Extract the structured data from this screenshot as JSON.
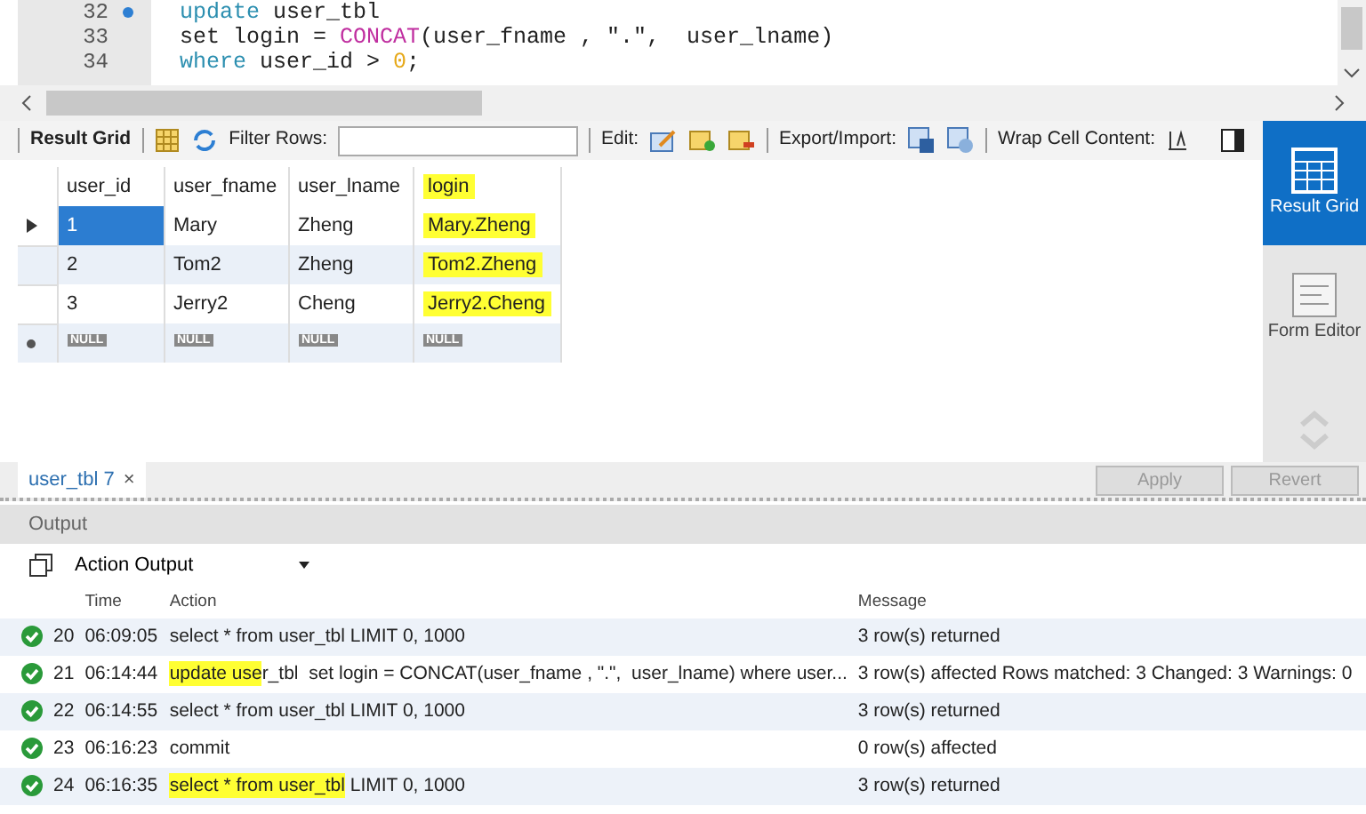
{
  "editor": {
    "lines": [
      {
        "number": "32",
        "marker": true,
        "tokens": [
          {
            "text": "update",
            "kind": "keyword"
          },
          {
            "text": " user_tbl",
            "kind": "plain"
          }
        ]
      },
      {
        "number": "33",
        "marker": false,
        "tokens": [
          {
            "text": "set login = ",
            "kind": "plain"
          },
          {
            "text": "CONCAT",
            "kind": "function"
          },
          {
            "text": "(user_fname , \".\",  user_lname)",
            "kind": "plain"
          }
        ]
      },
      {
        "number": "34",
        "marker": false,
        "tokens": [
          {
            "text": "where",
            "kind": "keyword"
          },
          {
            "text": " user_id > ",
            "kind": "plain"
          },
          {
            "text": "0",
            "kind": "number"
          },
          {
            "text": ";",
            "kind": "plain"
          }
        ]
      }
    ]
  },
  "toolbar": {
    "result_grid": "Result Grid",
    "filter_label": "Filter Rows:",
    "edit_label": "Edit:",
    "export_label": "Export/Import:",
    "wrap_label": "Wrap Cell Content:"
  },
  "grid": {
    "columns": [
      {
        "label": "user_id",
        "highlighted": false
      },
      {
        "label": "user_fname",
        "highlighted": false
      },
      {
        "label": "user_lname",
        "highlighted": false
      },
      {
        "label": "login",
        "highlighted": true
      }
    ],
    "rows": [
      {
        "selected": true,
        "cells": [
          "1",
          "Mary",
          "Zheng",
          "Mary.Zheng"
        ]
      },
      {
        "selected": false,
        "cells": [
          "2",
          "Tom2",
          "Zheng",
          "Tom2.Zheng"
        ]
      },
      {
        "selected": false,
        "cells": [
          "3",
          "Jerry2",
          "Cheng",
          "Jerry2.Cheng"
        ]
      }
    ],
    "new_row": [
      "NULL",
      "NULL",
      "NULL",
      "NULL"
    ]
  },
  "side_panel": [
    {
      "label": "Result Grid",
      "selected": true
    },
    {
      "label": "Form Editor",
      "selected": false
    }
  ],
  "result_tab": {
    "label": "user_tbl 7",
    "close": "×"
  },
  "buttons": [
    "Apply",
    "Revert"
  ],
  "output": {
    "title": "Output",
    "selector": "Action Output",
    "columns": [
      "Time",
      "Action",
      "Message"
    ],
    "rows": [
      {
        "number": "20",
        "time": "06:09:05",
        "action": [
          {
            "text": "select * from user_tbl LIMIT 0, 1000",
            "highlighted": false
          }
        ],
        "message": "3 row(s) returned"
      },
      {
        "number": "21",
        "time": "06:14:44",
        "action": [
          {
            "text": "update use",
            "highlighted": true
          },
          {
            "text": "r_tbl  set login = CONCAT(user_fname , \".\",  user_lname) where user...",
            "highlighted": false
          }
        ],
        "message": "3 row(s) affected Rows matched: 3  Changed: 3  Warnings: 0"
      },
      {
        "number": "22",
        "time": "06:14:55",
        "action": [
          {
            "text": "select * from user_tbl LIMIT 0, 1000",
            "highlighted": false
          }
        ],
        "message": "3 row(s) returned"
      },
      {
        "number": "23",
        "time": "06:16:23",
        "action": [
          {
            "text": "commit",
            "highlighted": false
          }
        ],
        "message": "0 row(s) affected"
      },
      {
        "number": "24",
        "time": "06:16:35",
        "action": [
          {
            "text": "select * from user_tbl",
            "highlighted": true
          },
          {
            "text": " LIMIT 0, 1000",
            "highlighted": false
          }
        ],
        "message": "3 row(s) returned"
      }
    ]
  }
}
